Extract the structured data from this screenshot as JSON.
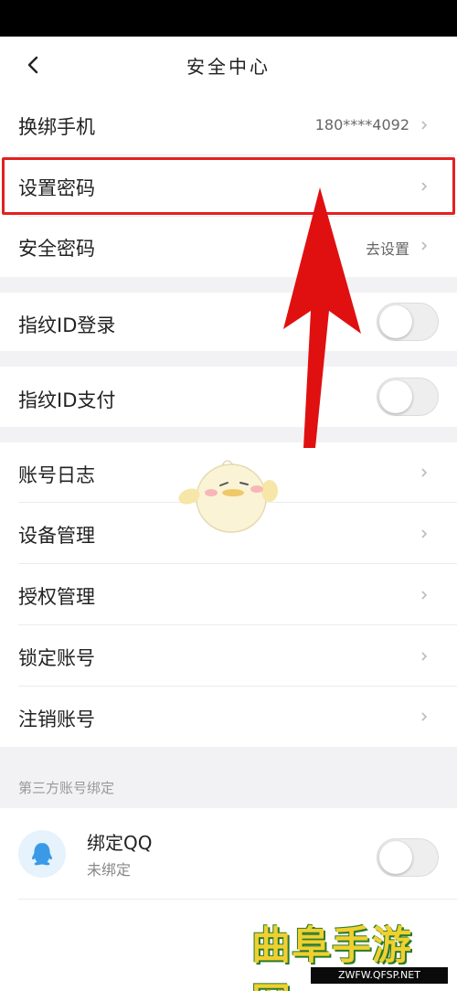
{
  "header": {
    "title": "安全中心"
  },
  "rows": [
    {
      "label": "换绑手机",
      "value": "180****4092"
    },
    {
      "label": "设置密码",
      "value": ""
    },
    {
      "label": "安全密码",
      "value": "去设置"
    }
  ],
  "toggles": [
    {
      "label": "指纹ID登录",
      "on": false
    },
    {
      "label": "指纹ID支付",
      "on": false
    }
  ],
  "account_rows": [
    {
      "label": "账号日志"
    },
    {
      "label": "设备管理"
    },
    {
      "label": "授权管理"
    },
    {
      "label": "锁定账号"
    },
    {
      "label": "注销账号"
    }
  ],
  "third_party": {
    "caption": "第三方账号绑定",
    "qq": {
      "title": "绑定QQ",
      "status": "未绑定",
      "on": false
    }
  },
  "watermark": {
    "main": "曲阜手游网",
    "sub": "ZWFW.QFSP.NET"
  },
  "colors": {
    "highlight": "#e32020",
    "arrow": "#e01010",
    "caption": "#999999"
  }
}
